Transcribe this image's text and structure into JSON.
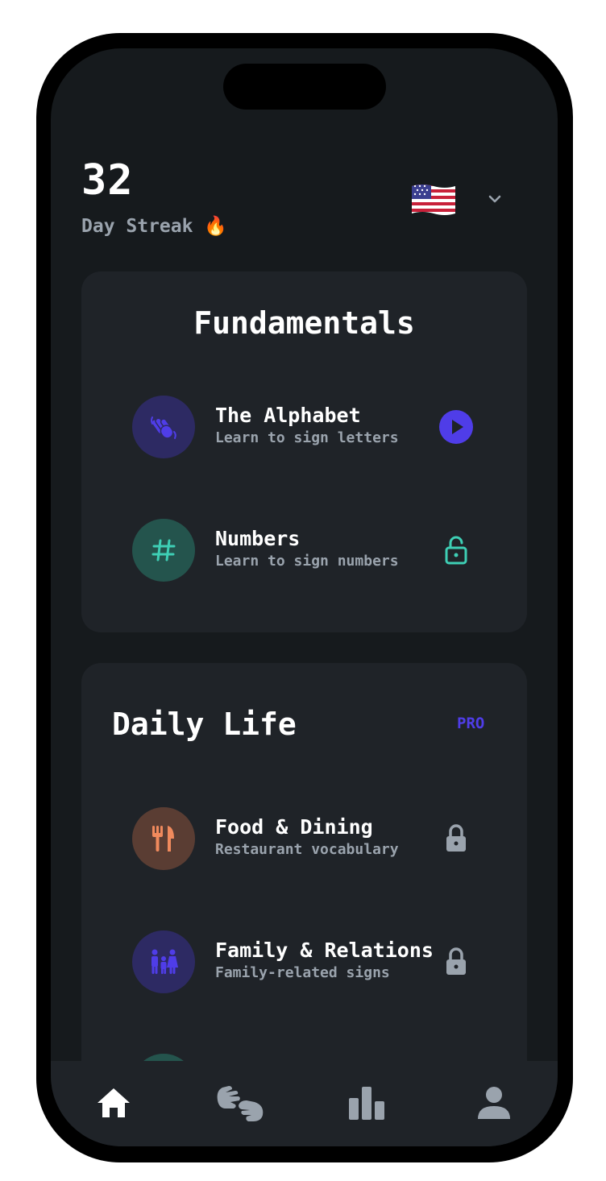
{
  "header": {
    "streak_count": "32",
    "streak_label": "Day Streak 🔥",
    "language_flag": "us-flag-icon"
  },
  "sections": [
    {
      "title": "Fundamentals",
      "lessons": [
        {
          "title": "The Alphabet",
          "subtitle": "Learn to sign letters",
          "icon": "hand-wave-icon",
          "action": "play-icon"
        },
        {
          "title": "Numbers",
          "subtitle": "Learn to sign numbers",
          "icon": "hash-icon",
          "action": "unlock-icon"
        }
      ]
    },
    {
      "title": "Daily Life",
      "badge": "PRO",
      "lessons": [
        {
          "title": "Food & Dining",
          "subtitle": "Restaurant vocabulary",
          "icon": "utensils-icon",
          "action": "lock-icon"
        },
        {
          "title": "Family & Relations",
          "subtitle": "Family-related signs",
          "icon": "family-icon",
          "action": "lock-icon"
        }
      ]
    }
  ],
  "tabs": [
    "home-icon",
    "sign-language-icon",
    "stats-icon",
    "profile-icon"
  ],
  "colors": {
    "background": "#161a1d",
    "card": "#1f2328",
    "accent_purple": "#4f3de8",
    "accent_teal": "#3ecfb5",
    "accent_orange": "#f08a5d",
    "muted_text": "#9aa3ad"
  }
}
